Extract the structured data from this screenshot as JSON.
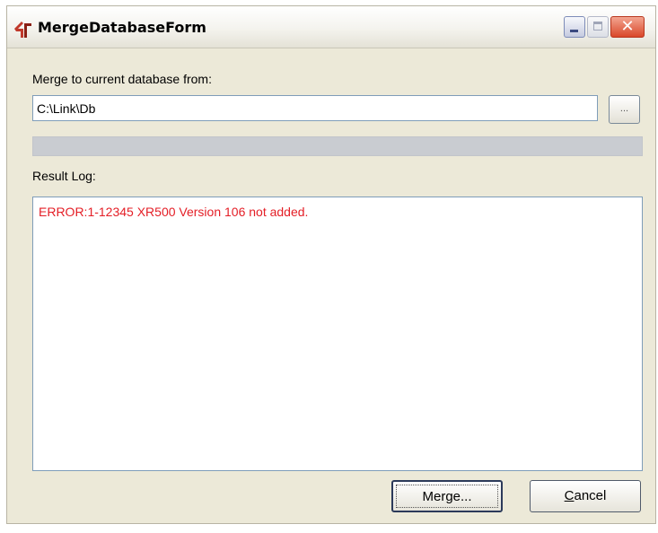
{
  "window": {
    "title": "MergeDatabaseForm",
    "controls": {
      "minimize_icon": "minimize-icon",
      "maximize_icon": "maximize-icon",
      "close_icon": "close-icon",
      "close_glyph": "✕"
    }
  },
  "form": {
    "merge_from_label": "Merge to current database from:",
    "path_value": "C:\\Link\\Db",
    "browse_label": "...",
    "progress_fraction": 0,
    "result_log_label": "Result Log:",
    "log_lines": [
      "ERROR:1-12345 XR500 Version 106 not added."
    ]
  },
  "buttons": {
    "merge_label": "Merge...",
    "cancel_label": "Cancel"
  },
  "colors": {
    "error_text": "#e41e26",
    "window_bg": "#ece9d8"
  }
}
